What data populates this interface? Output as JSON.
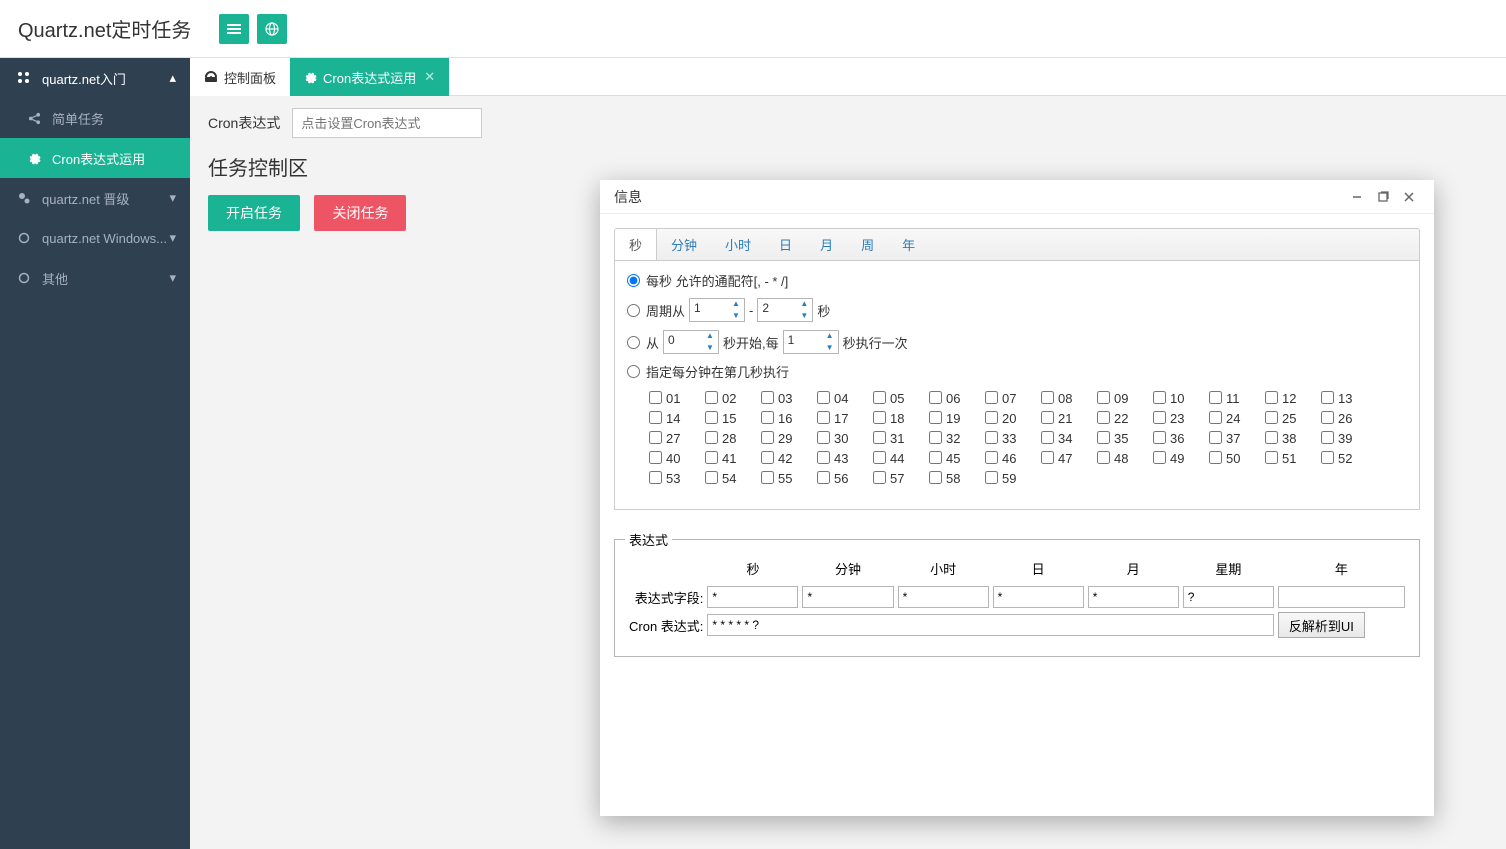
{
  "header": {
    "title": "Quartz.net定时任务"
  },
  "sidebar": {
    "items": [
      {
        "label": "quartz.net入门",
        "expanded": true,
        "chevron": "up"
      },
      {
        "label": "简单任务",
        "sub": true
      },
      {
        "label": "Cron表达式运用",
        "sub": true,
        "active": true
      },
      {
        "label": "quartz.net 晋级",
        "chevron": "down"
      },
      {
        "label": "quartz.net Windows...",
        "chevron": "down"
      },
      {
        "label": "其他",
        "chevron": "down"
      }
    ]
  },
  "tabs": [
    {
      "label": "控制面板",
      "active": false
    },
    {
      "label": "Cron表达式运用",
      "active": true,
      "closable": true
    }
  ],
  "content": {
    "cron_label": "Cron表达式",
    "cron_placeholder": "点击设置Cron表达式",
    "section_title": "任务控制区",
    "start_btn": "开启任务",
    "stop_btn": "关闭任务"
  },
  "dialog": {
    "title": "信息",
    "tabs": [
      "秒",
      "分钟",
      "小时",
      "日",
      "月",
      "周",
      "年"
    ],
    "active_tab": 0,
    "opt1": "每秒 允许的通配符[, - * /]",
    "opt2_a": "周期从",
    "opt2_v1": "1",
    "opt2_sep": "-",
    "opt2_v2": "2",
    "opt2_b": "秒",
    "opt3_a": "从",
    "opt3_v1": "0",
    "opt3_b": "秒开始,每",
    "opt3_v2": "1",
    "opt3_c": "秒执行一次",
    "opt4": "指定每分钟在第几秒执行",
    "grid": [
      "01",
      "02",
      "03",
      "04",
      "05",
      "06",
      "07",
      "08",
      "09",
      "10",
      "11",
      "12",
      "13",
      "14",
      "15",
      "16",
      "17",
      "18",
      "19",
      "20",
      "21",
      "22",
      "23",
      "24",
      "25",
      "26",
      "27",
      "28",
      "29",
      "30",
      "31",
      "32",
      "33",
      "34",
      "35",
      "36",
      "37",
      "38",
      "39",
      "40",
      "41",
      "42",
      "43",
      "44",
      "45",
      "46",
      "47",
      "48",
      "49",
      "50",
      "51",
      "52",
      "53",
      "54",
      "55",
      "56",
      "57",
      "58",
      "59"
    ],
    "fieldset": {
      "legend": "表达式",
      "headers": [
        "秒",
        "分钟",
        "小时",
        "日",
        "月",
        "星期",
        "年"
      ],
      "row1_label": "表达式字段:",
      "row1_values": [
        "*",
        "*",
        "*",
        "*",
        "*",
        "?",
        ""
      ],
      "row2_label": "Cron 表达式:",
      "row2_value": "* * * * * ?",
      "parse_btn": "反解析到UI"
    }
  }
}
